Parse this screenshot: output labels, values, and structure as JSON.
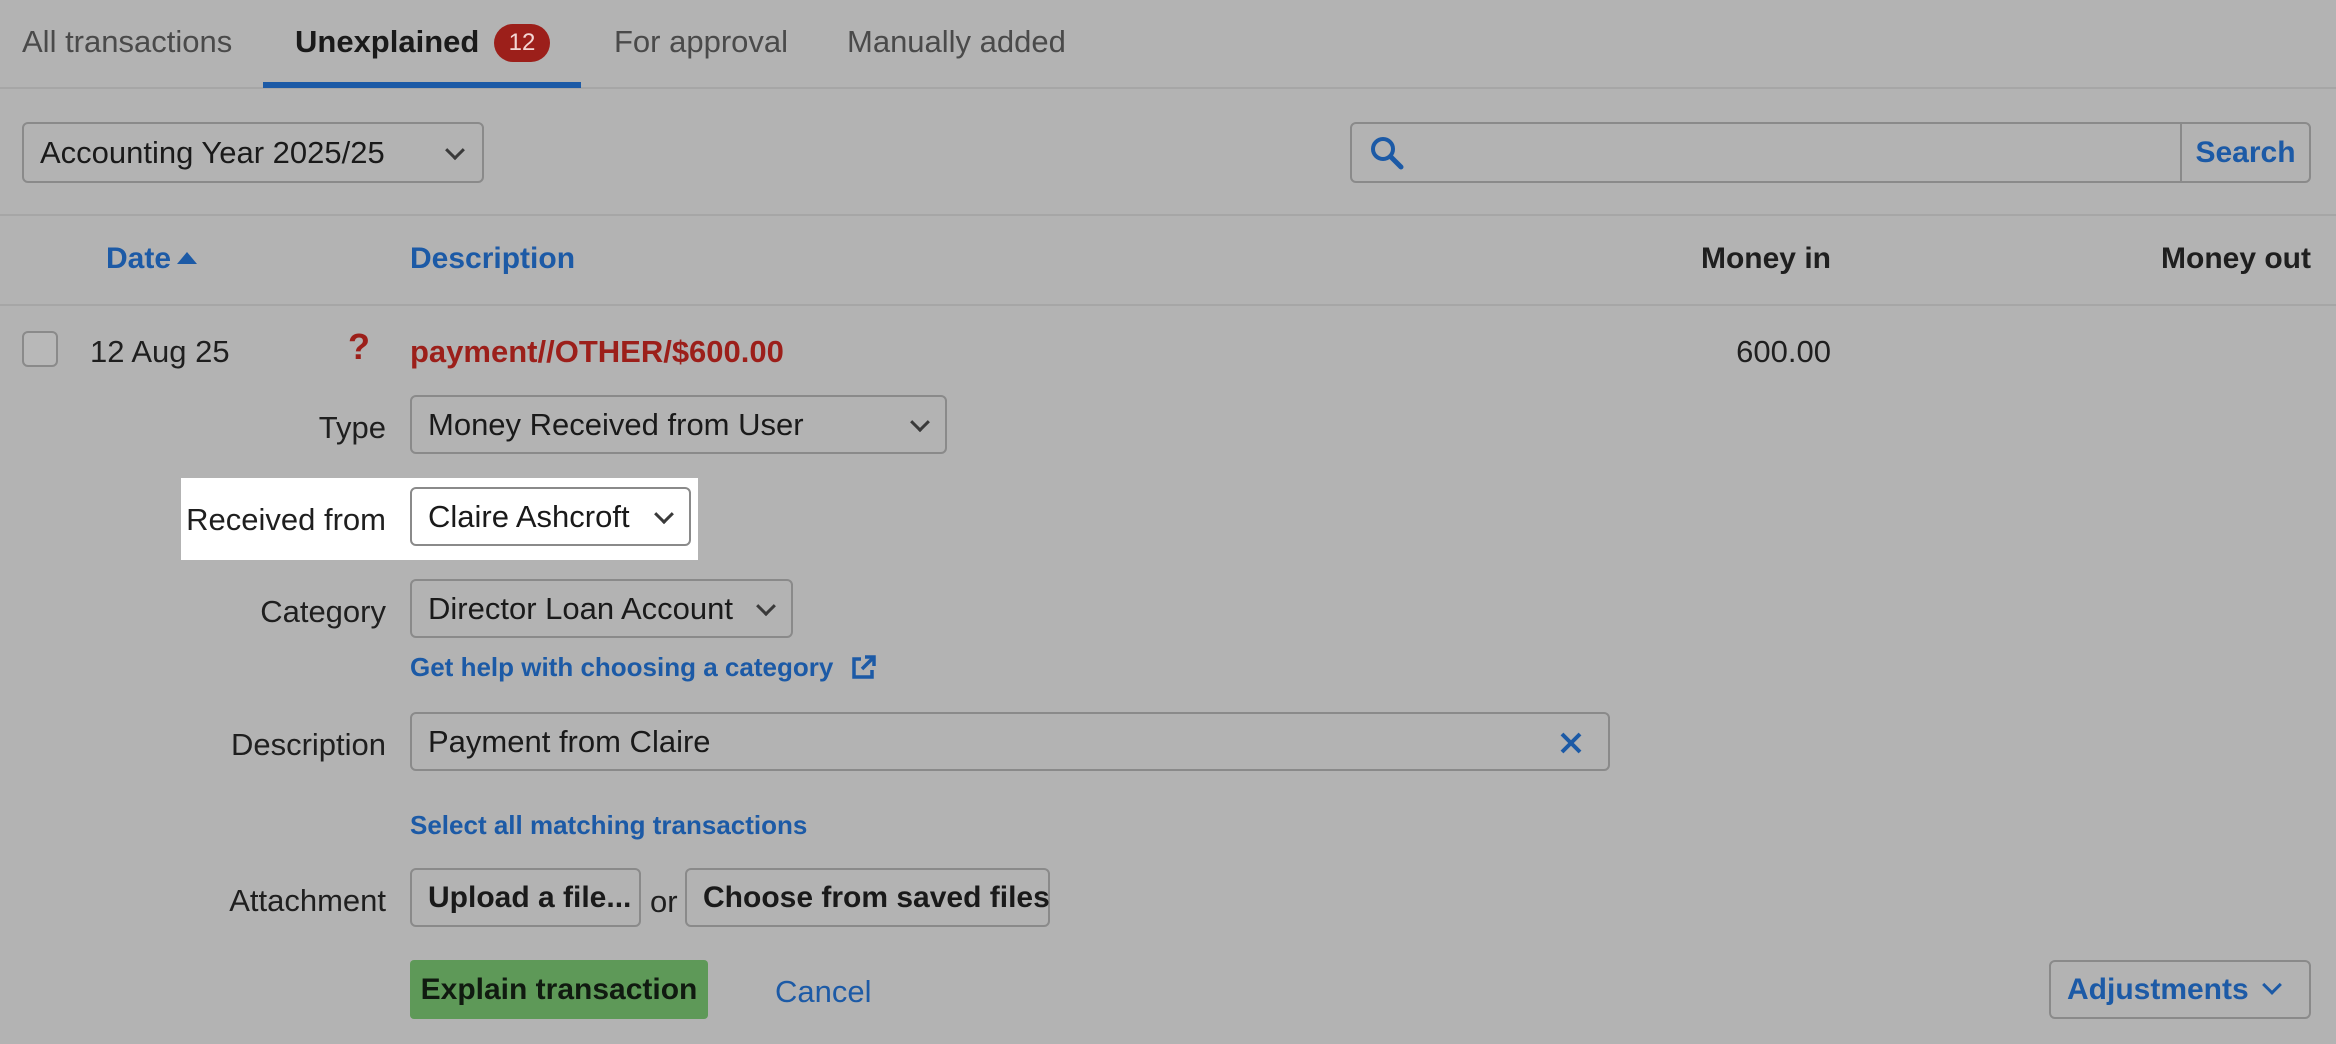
{
  "tabs": {
    "all": "All transactions",
    "unexplained": "Unexplained",
    "unexplained_count": "12",
    "approval": "For approval",
    "manual": "Manually added"
  },
  "filters": {
    "year": "Accounting Year 2025/25",
    "search_button": "Search",
    "search_value": ""
  },
  "columns": {
    "date": "Date",
    "description": "Description",
    "money_in": "Money in",
    "money_out": "Money out"
  },
  "transaction": {
    "date": "12 Aug 25",
    "status_mark": "?",
    "description": "payment//OTHER/$600.00",
    "money_in": "600.00",
    "money_out": ""
  },
  "form": {
    "type_label": "Type",
    "type_value": "Money Received from User",
    "received_from_label": "Received from",
    "received_from_value": "Claire Ashcroft",
    "category_label": "Category",
    "category_value": "Director Loan Account",
    "category_help_link": "Get help with choosing a category",
    "description_label": "Description",
    "description_value": "Payment from Claire",
    "select_matching_link": "Select all matching transactions",
    "attachment_label": "Attachment",
    "upload_button": "Upload a file...",
    "or_text": "or",
    "choose_saved_button": "Choose from saved files",
    "explain_button": "Explain transaction",
    "cancel_link": "Cancel",
    "adjustments_button": "Adjustments"
  },
  "colors": {
    "accent": "#1c5aa6",
    "badge": "#9c1f1a",
    "primary_button": "#5e9958",
    "background": "#b3b3b3"
  }
}
